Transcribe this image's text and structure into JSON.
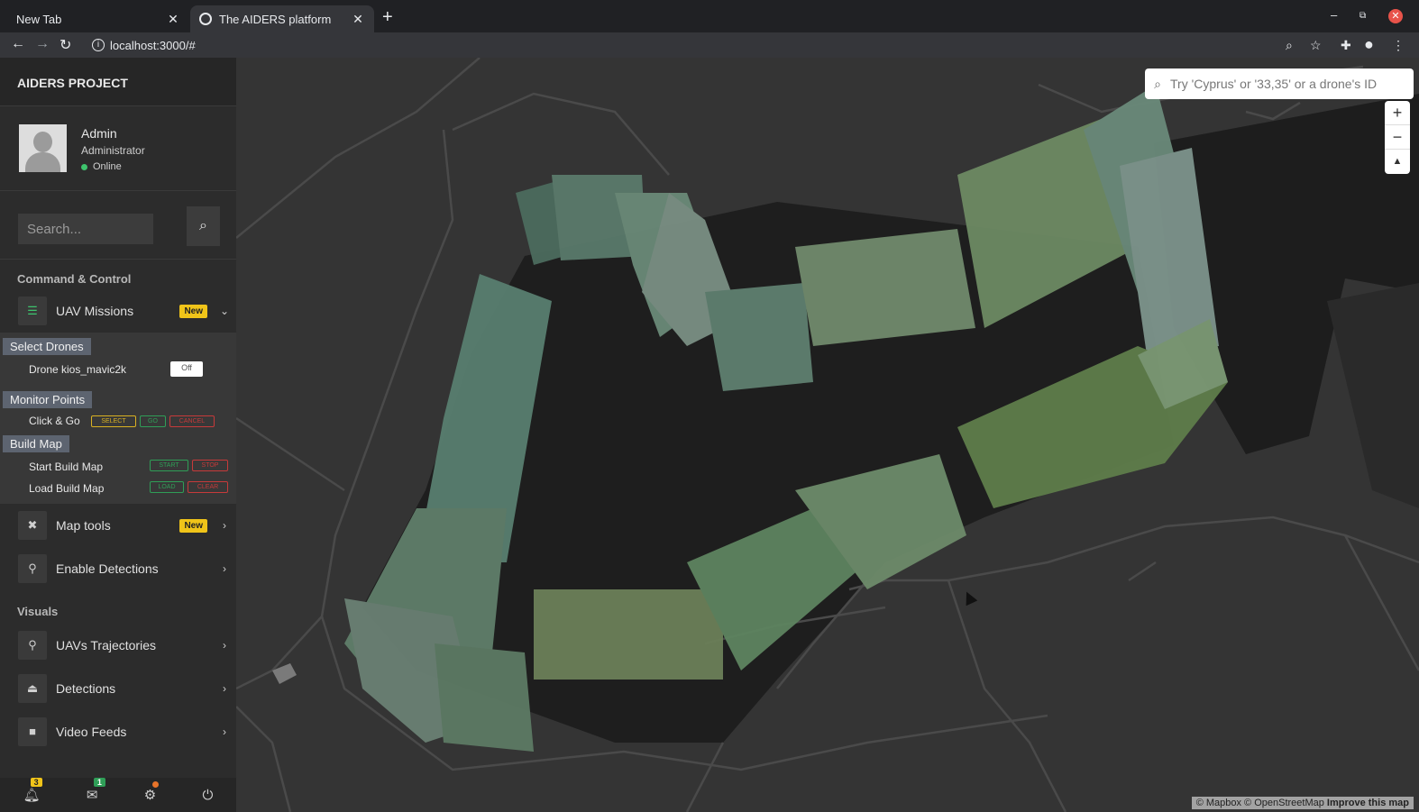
{
  "browser": {
    "tabs": [
      {
        "title": "New Tab"
      },
      {
        "title": "The AIDERS platform"
      }
    ],
    "url": "localhost:3000/#"
  },
  "sidebar": {
    "brand": "AIDERS PROJECT",
    "user": {
      "name": "Admin",
      "role": "Administrator",
      "status": "Online"
    },
    "search_placeholder": "Search...",
    "sections": {
      "command": "Command & Control",
      "visuals": "Visuals"
    },
    "uav_missions": {
      "label": "UAV Missions",
      "badge": "New",
      "select_drones": "Select Drones",
      "drone_label": "Drone kios_mavic2k",
      "drone_toggle": "Off",
      "monitor_points": "Monitor Points",
      "click_go": "Click & Go",
      "select_btn": "SELECT",
      "go_btn": "GO",
      "cancel_btn": "CANCEL",
      "build_map": "Build Map",
      "start_build": "Start Build Map",
      "start_btn": "START",
      "stop_btn": "STOP",
      "load_build": "Load Build Map",
      "load_btn": "LOAD",
      "clear_btn": "CLEAR"
    },
    "map_tools": {
      "label": "Map tools",
      "badge": "New"
    },
    "enable_detections": {
      "label": "Enable Detections"
    },
    "uav_trajectories": {
      "label": "UAVs Trajectories"
    },
    "detections": {
      "label": "Detections"
    },
    "video_feeds": {
      "label": "Video Feeds"
    },
    "footer": {
      "notifications": "3",
      "messages": "1"
    }
  },
  "map": {
    "geocoder_placeholder": "Try 'Cyprus' or '33,35' or a drone's ID",
    "attribution": "© Mapbox © OpenStreetMap",
    "improve": "Improve this map"
  },
  "colors": {
    "map_bg": "#343434",
    "water": "#1e1e1e",
    "badge_new": "#f0c419",
    "online": "#3ec46d"
  }
}
